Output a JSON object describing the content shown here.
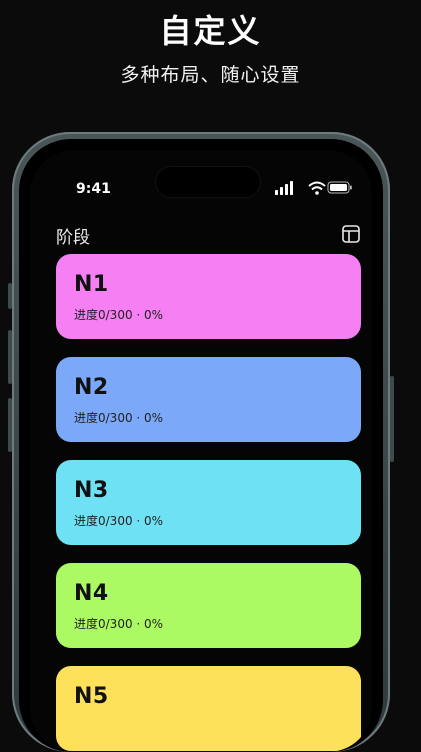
{
  "promo": {
    "title": "自定义",
    "subtitle": "多种布局、随心设置"
  },
  "status_bar": {
    "time": "9:41",
    "icons": [
      "signal-icon",
      "wifi-icon",
      "battery-icon"
    ]
  },
  "header": {
    "title": "阶段",
    "action_icon": "layout-icon"
  },
  "cards": [
    {
      "name": "N1",
      "progress": "进度0/300 · 0%",
      "color": "#f57ff3"
    },
    {
      "name": "N2",
      "progress": "进度0/300 · 0%",
      "color": "#7ba8f9"
    },
    {
      "name": "N3",
      "progress": "进度0/300 · 0%",
      "color": "#6fe1f4"
    },
    {
      "name": "N4",
      "progress": "进度0/300 · 0%",
      "color": "#acfa63"
    },
    {
      "name": "N5",
      "progress": "",
      "color": "#fde15b"
    }
  ]
}
